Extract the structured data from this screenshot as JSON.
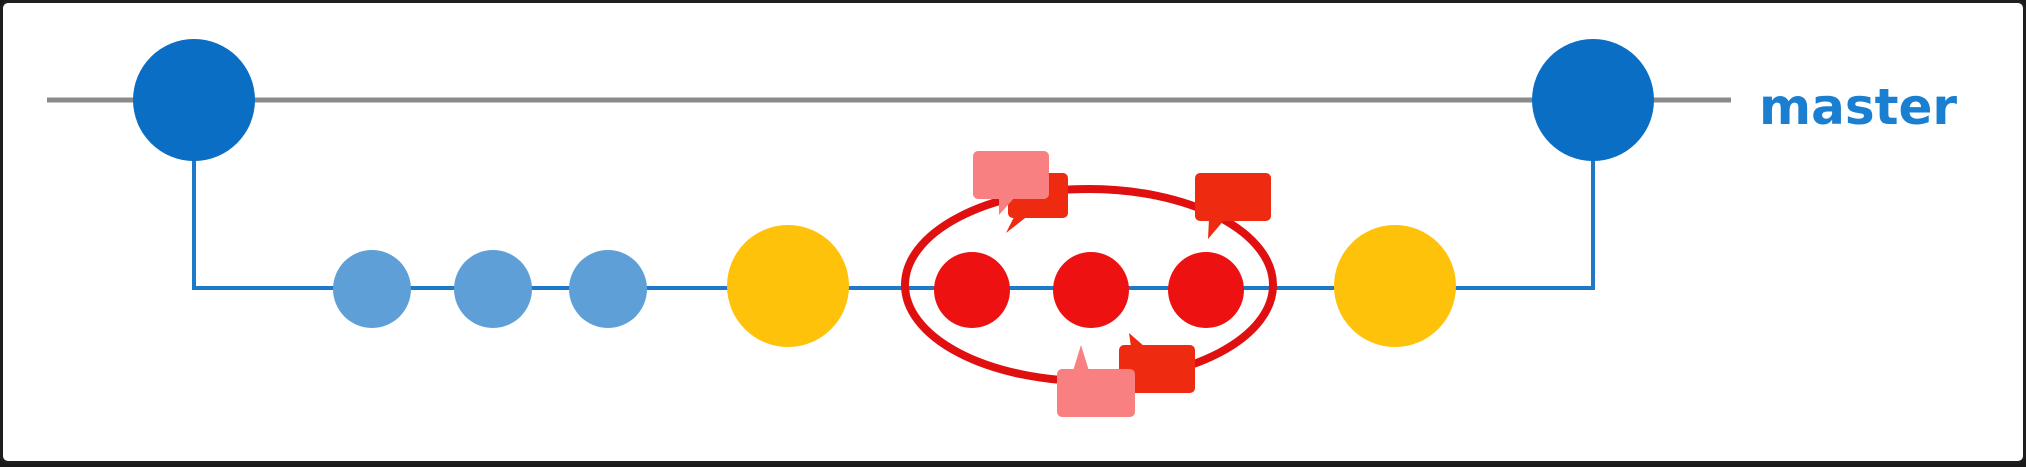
{
  "labels": {
    "branch": "master"
  },
  "colors": {
    "main_line": "#8a8a8a",
    "branch_line": "#1f78c8",
    "master_commit": "#0a6ec4",
    "branch_commit": "#5f9fd8",
    "merge_commit": "#ffc20a",
    "highlight_commit": "#ee1111",
    "highlight_ring": "#e01010",
    "comment_light": "#f88080",
    "comment_dark": "#ee2a10",
    "label_text": "#1a7fd0"
  },
  "icons": [
    "comment-bubble-icon"
  ],
  "commits": [
    {
      "kind": "master",
      "branch": "master"
    },
    {
      "kind": "master",
      "branch": "master"
    },
    {
      "kind": "feature",
      "branch": "feature"
    },
    {
      "kind": "feature",
      "branch": "feature"
    },
    {
      "kind": "feature",
      "branch": "feature"
    },
    {
      "kind": "merge",
      "branch": "feature"
    },
    {
      "kind": "highlight",
      "branch": "feature"
    },
    {
      "kind": "highlight",
      "branch": "feature"
    },
    {
      "kind": "highlight",
      "branch": "feature"
    },
    {
      "kind": "merge",
      "branch": "feature"
    }
  ]
}
